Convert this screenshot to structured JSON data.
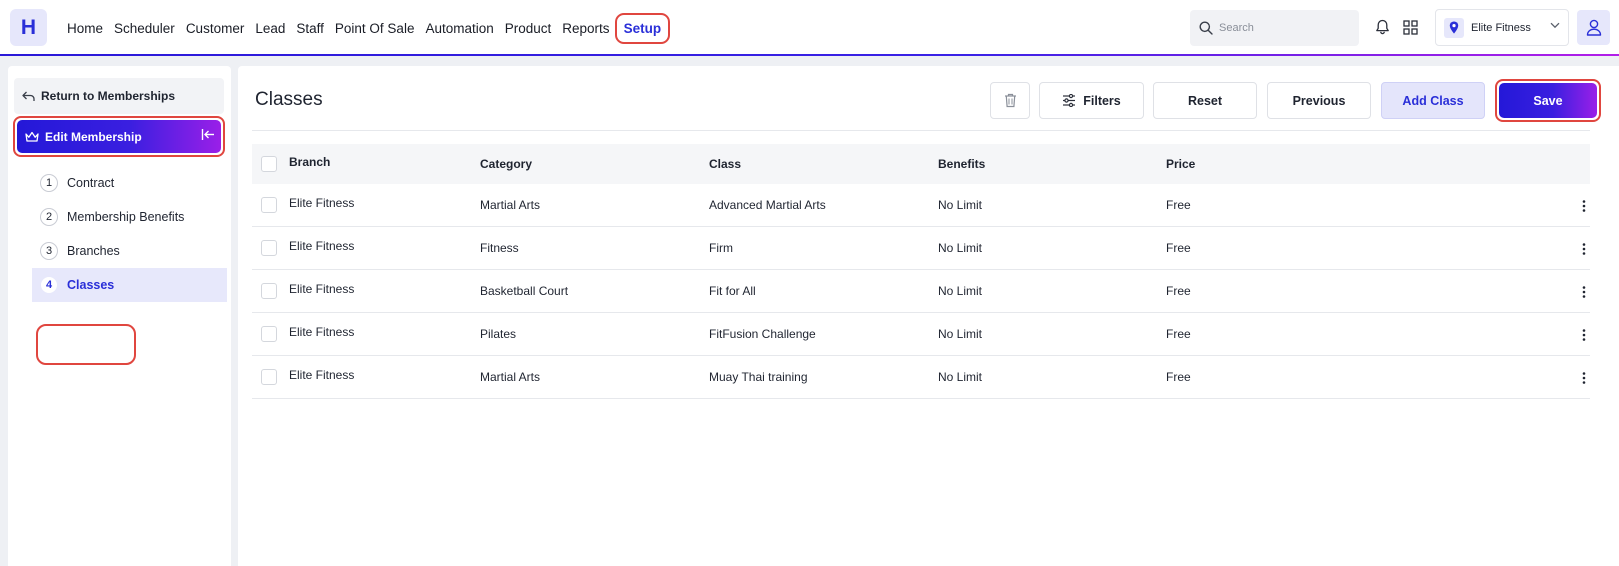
{
  "app": {
    "logo_letter": "H"
  },
  "nav": {
    "items": [
      "Home",
      "Scheduler",
      "Customer",
      "Lead",
      "Staff",
      "Point Of Sale",
      "Automation",
      "Product",
      "Reports",
      "Setup"
    ],
    "active": "Setup"
  },
  "header": {
    "search_placeholder": "Search",
    "branch_name": "Elite Fitness"
  },
  "sidebar": {
    "return_label": "Return to Memberships",
    "edit_label": "Edit Membership",
    "steps": [
      {
        "num": "1",
        "label": "Contract"
      },
      {
        "num": "2",
        "label": "Membership Benefits"
      },
      {
        "num": "3",
        "label": "Branches"
      },
      {
        "num": "4",
        "label": "Classes"
      }
    ],
    "active_step": "Classes"
  },
  "main": {
    "title": "Classes",
    "buttons": {
      "filters": "Filters",
      "reset": "Reset",
      "previous": "Previous",
      "add_class": "Add Class",
      "save": "Save"
    },
    "table": {
      "headers": {
        "branch": "Branch",
        "category": "Category",
        "class": "Class",
        "benefits": "Benefits",
        "price": "Price"
      },
      "rows": [
        {
          "branch": "Elite Fitness",
          "category": "Martial Arts",
          "class": "Advanced Martial Arts",
          "benefits": "No Limit",
          "price": "Free"
        },
        {
          "branch": "Elite Fitness",
          "category": "Fitness",
          "class": "Firm",
          "benefits": "No Limit",
          "price": "Free"
        },
        {
          "branch": "Elite Fitness",
          "category": "Basketball Court",
          "class": "Fit for All",
          "benefits": "No Limit",
          "price": "Free"
        },
        {
          "branch": "Elite Fitness",
          "category": "Pilates",
          "class": "FitFusion Challenge",
          "benefits": "No Limit",
          "price": "Free"
        },
        {
          "branch": "Elite Fitness",
          "category": "Martial Arts",
          "class": "Muay Thai training",
          "benefits": "No Limit",
          "price": "Free"
        }
      ]
    }
  },
  "colors": {
    "accent": "#2a2fd8",
    "highlight": "#e0463f",
    "gradient_end": "#9a1fe8"
  }
}
